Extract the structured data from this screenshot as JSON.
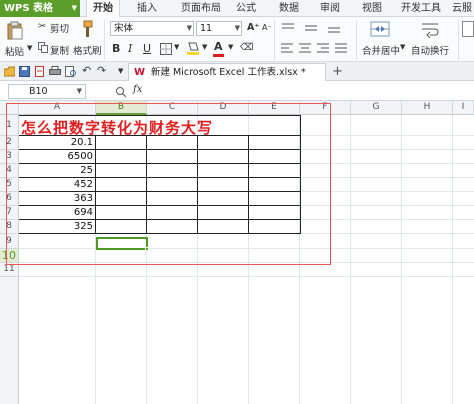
{
  "app": {
    "name": "WPS 表格",
    "logo": "S"
  },
  "menu_tabs": [
    "开始",
    "插入",
    "页面布局",
    "公式",
    "数据",
    "审阅",
    "视图",
    "开发工具",
    "云服"
  ],
  "active_tab": "开始",
  "ribbon": {
    "paste_label": "粘贴",
    "cut_label": "剪切",
    "copy_label": "复制",
    "format_painter_label": "格式刷",
    "font_name": "宋体",
    "font_size": "11",
    "bold": "B",
    "italic": "I",
    "underline": "U",
    "merge_center_label": "合并居中",
    "wrap_text_label": "自动换行",
    "colors": {
      "font_color": "#e02020",
      "fill_color": "#f5d23a"
    }
  },
  "document_tab": {
    "title": "新建 Microsoft Excel 工作表.xlsx *",
    "add_tab": "+"
  },
  "formula_bar": {
    "name_box": "B10",
    "fx": "fx",
    "formula": ""
  },
  "columns": [
    "A",
    "B",
    "C",
    "D",
    "E",
    "F",
    "G",
    "H",
    "I"
  ],
  "selected_column": "B",
  "rows": [
    "1",
    "2",
    "3",
    "4",
    "5",
    "6",
    "7",
    "8",
    "9",
    "10",
    "11"
  ],
  "selected_row": "10",
  "sheet": {
    "title": "怎么把数字转化为财务大写",
    "values": [
      "20.1",
      "6500",
      "25",
      "452",
      "363",
      "694",
      "325"
    ]
  },
  "accent_color": "#5b9f2a"
}
